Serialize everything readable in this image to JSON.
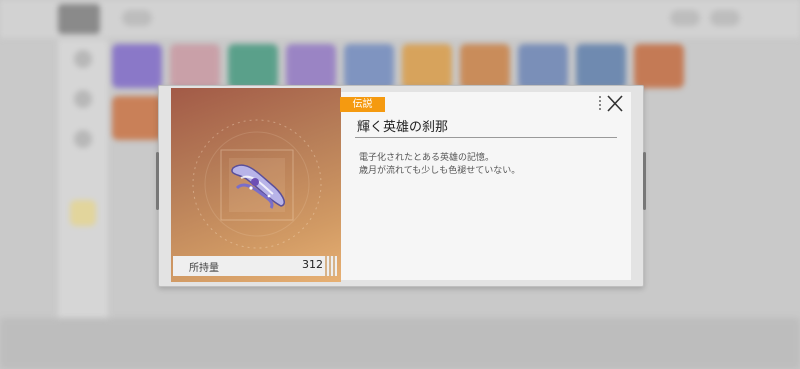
{
  "item": {
    "rarity": "伝説",
    "name": "輝く英雄の刹那",
    "description_line1": "電子化されたとある英雄の記憶。",
    "description_line2": "歳月が流れても少しも色褪せていない。"
  },
  "quantity": {
    "label": "所持量",
    "value": "312"
  },
  "icons": {
    "close": "close-icon",
    "item": "ribbon-item-icon"
  },
  "colors": {
    "rarity_badge": "#f59a10",
    "art_gradient_top": "#a25a47",
    "art_gradient_bottom": "#e7b073"
  }
}
